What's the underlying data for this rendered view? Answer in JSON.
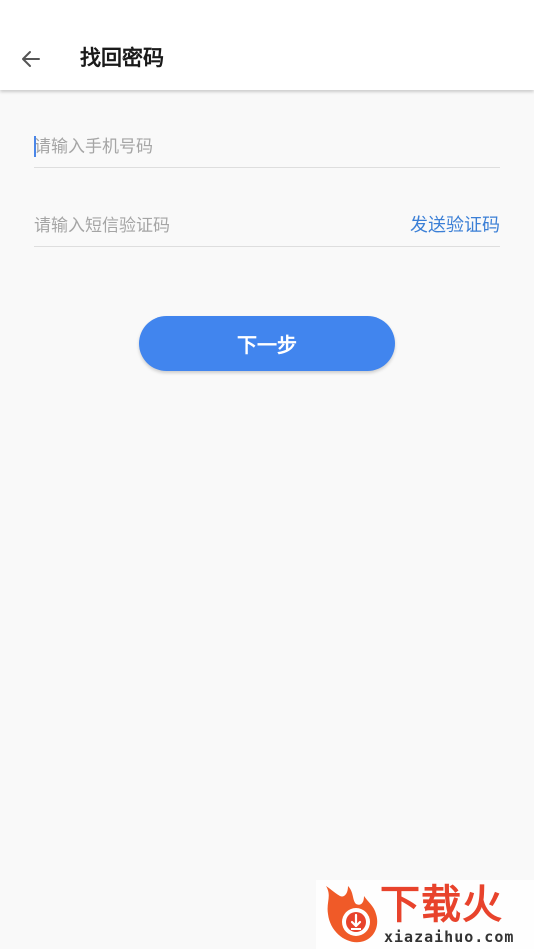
{
  "header": {
    "title": "找回密码"
  },
  "form": {
    "phone_placeholder": "请输入手机号码",
    "code_placeholder": "请输入短信验证码",
    "send_code_label": "发送验证码",
    "next_label": "下一步"
  },
  "watermark": {
    "brand": "下载火",
    "url": "xiazaihuo.com"
  },
  "colors": {
    "accent": "#4185ee",
    "link": "#3b7fd6",
    "brand": "#e8432c"
  },
  "icons": {
    "back": "arrow-left-icon",
    "logo": "flame-download-icon"
  }
}
